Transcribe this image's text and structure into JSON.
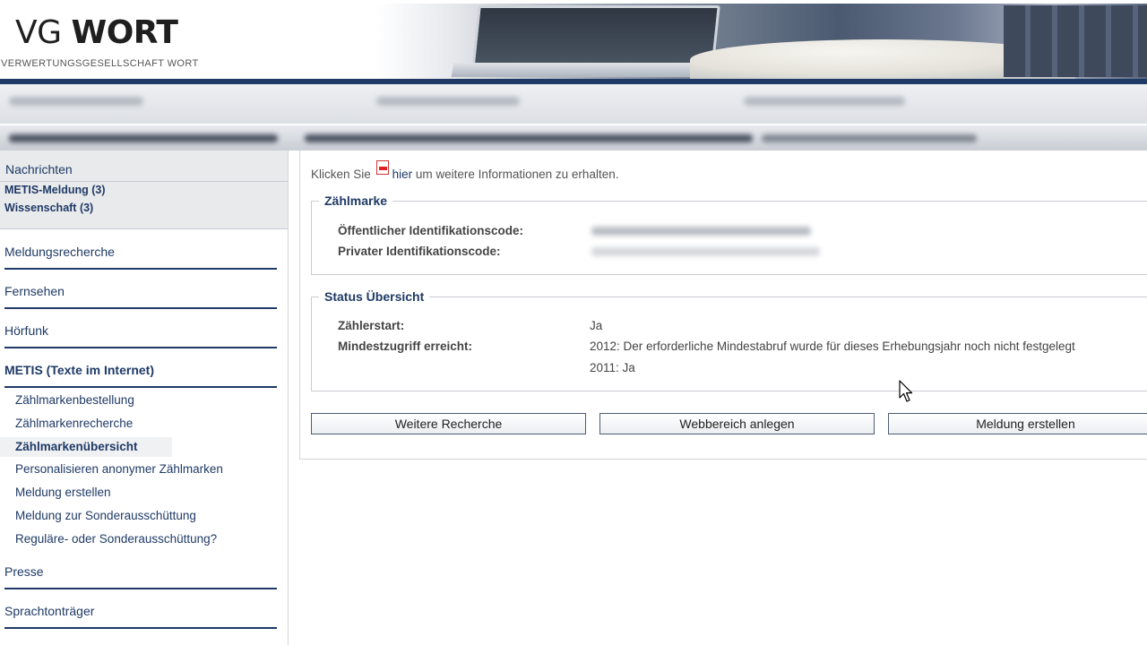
{
  "header": {
    "logo_vg": "VG",
    "logo_wort": "WORT",
    "logo_subtitle": "VERWERTUNGSGESELLSCHAFT WORT"
  },
  "sidebar": {
    "news_title": "Nachrichten",
    "news_items": [
      "METIS-Meldung (3)",
      "Wissenschaft (3)"
    ],
    "nav": {
      "meldungsrecherche": "Meldungsrecherche",
      "fernsehen": "Fernsehen",
      "hoerfunk": "Hörfunk",
      "metis": "METIS (Texte im Internet)",
      "presse": "Presse",
      "sprachtontraeger": "Sprachtonträger"
    },
    "metis_sub": [
      "Zählmarkenbestellung",
      "Zählmarkenrecherche",
      "Zählmarkenübersicht",
      "Personalisieren anonymer Zählmarken",
      "Meldung erstellen",
      "Meldung zur Sonderausschüttung",
      "Reguläre- oder Sonderausschüttung?"
    ]
  },
  "main": {
    "intro_prefix": "Klicken Sie",
    "intro_link": "hier",
    "intro_suffix": "um weitere Informationen zu erhalten.",
    "zaehlmarke": {
      "legend": "Zählmarke",
      "public_label": "Öffentlicher Identifikationscode:",
      "private_label": "Privater Identifikationscode:"
    },
    "status": {
      "legend": "Status Übersicht",
      "counter_label": "Zählerstart:",
      "counter_value": "Ja",
      "min_label": "Mindestzugriff erreicht:",
      "min_value_2012": "2012: Der erforderliche Mindestabruf wurde für dieses Erhebungsjahr noch nicht festgelegt",
      "min_value_2011": "2011: Ja"
    },
    "buttons": {
      "further_search": "Weitere Recherche",
      "web_area": "Webbereich anlegen",
      "create_report": "Meldung erstellen"
    }
  }
}
